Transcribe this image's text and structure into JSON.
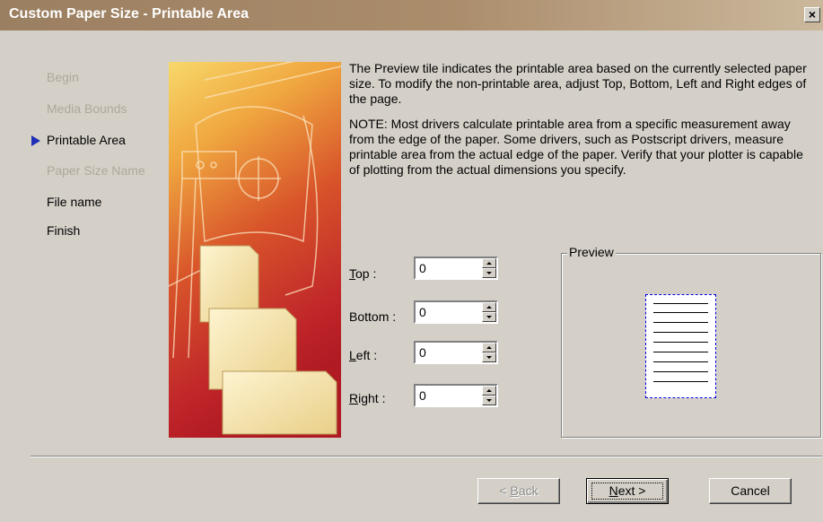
{
  "window": {
    "title": "Custom Paper Size - Printable Area",
    "close_label": "×"
  },
  "steps": [
    {
      "label": "Begin",
      "state": "done"
    },
    {
      "label": "Media Bounds",
      "state": "done"
    },
    {
      "label": "Printable Area",
      "state": "current"
    },
    {
      "label": "Paper Size Name",
      "state": "done"
    },
    {
      "label": "File name",
      "state": "todo"
    },
    {
      "label": "Finish",
      "state": "todo"
    }
  ],
  "description": {
    "para1": "The Preview tile indicates the printable area based on the currently selected paper size. To modify the non-printable area, adjust Top, Bottom, Left and Right edges of the page.",
    "para2": "NOTE: Most drivers calculate printable area from a specific measurement away from the edge of the paper. Some drivers, such as Postscript drivers, measure printable area from the actual edge of the paper. Verify that your plotter is capable of plotting from the actual dimensions you specify."
  },
  "fields": {
    "top": {
      "accel": "T",
      "rest": "op :",
      "value": "0"
    },
    "bottom": {
      "accel": "",
      "rest": "Bottom :",
      "value": "0"
    },
    "left": {
      "accel": "L",
      "rest": "eft :",
      "value": "0"
    },
    "right": {
      "accel": "R",
      "rest": "ight :",
      "value": "0"
    }
  },
  "preview": {
    "label": "Preview"
  },
  "buttons": {
    "back_accel": "B",
    "back_pre": "< ",
    "back_rest": "ack",
    "next_accel": "N",
    "next_rest": "ext >",
    "cancel": "Cancel"
  },
  "colors": {
    "step_arrow": "#1f2fb8",
    "preview_border": "#0000dd"
  }
}
